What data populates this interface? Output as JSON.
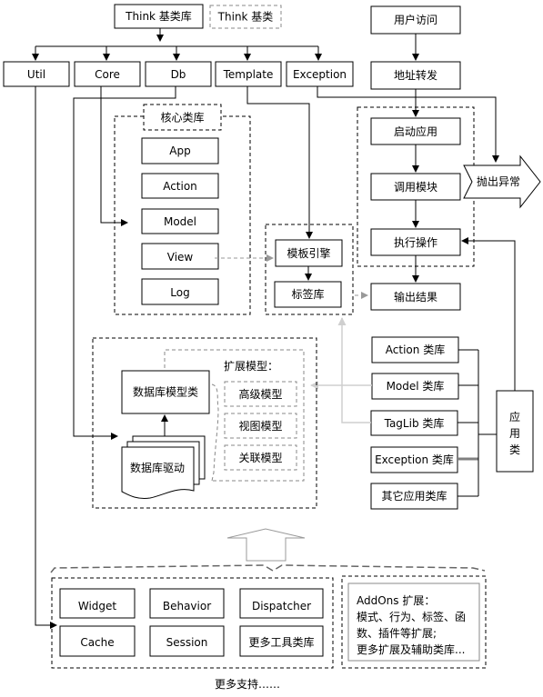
{
  "top": {
    "think_lib": "Think 基类库",
    "think_base_legend": "Think 基类"
  },
  "modules": [
    {
      "label": "Util"
    },
    {
      "label": "Core"
    },
    {
      "label": "Db"
    },
    {
      "label": "Template"
    },
    {
      "label": "Exception"
    }
  ],
  "core": {
    "title": "核心类库",
    "items": [
      "App",
      "Action",
      "Model",
      "View",
      "Log"
    ]
  },
  "template_group": {
    "engine": "模板引擎",
    "taglib": "标签库"
  },
  "flow": {
    "steps": [
      "用户访问",
      "地址转发",
      "启动应用",
      "调用模块",
      "执行操作",
      "输出结果"
    ],
    "exception": "抛出异常"
  },
  "app_libs": {
    "items": [
      "Action 类库",
      "Model 类库",
      "TagLib 类库",
      "Exception 类库",
      "其它应用类库"
    ],
    "group_label": [
      "应",
      "用",
      "类"
    ]
  },
  "db": {
    "model_class": "数据库模型类",
    "driver": "数据库驱动",
    "ext_title": "扩展模型：",
    "ext_models": [
      "高级模型",
      "视图模型",
      "关联模型"
    ]
  },
  "tools": {
    "items": [
      "Widget",
      "Behavior",
      "Dispatcher",
      "Cache",
      "Session",
      "更多工具类库"
    ]
  },
  "addons": {
    "lines": [
      "AddOns 扩展：",
      "模式、行为、标签、函",
      "数、插件等扩展;",
      "更多扩展及辅助类库..."
    ]
  },
  "footer": {
    "more": "更多支持……"
  }
}
